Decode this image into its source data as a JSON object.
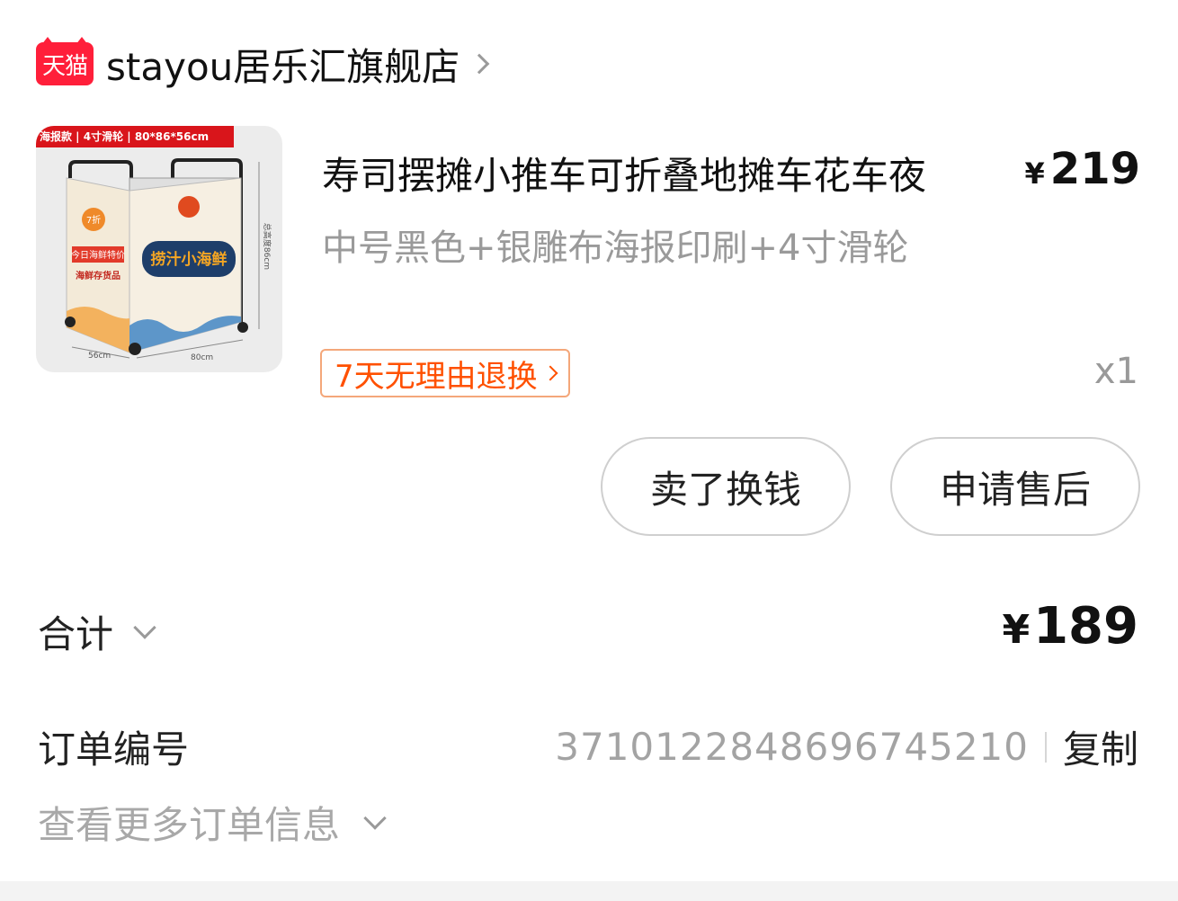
{
  "store": {
    "badge": "天猫",
    "name": "stayou居乐汇旗舰店"
  },
  "product": {
    "image_banner": "海报款 | 4寸滑轮 | 80*86*56cm",
    "image_text_1": "捞汁小海鲜",
    "image_text_2": "今日海鲜特价",
    "image_text_3": "海鲜存货品",
    "image_text_4": "7折",
    "image_dim_height": "总高度86cm",
    "image_dim_width": "80cm",
    "image_dim_depth": "56cm",
    "title": "寿司摆摊小推车可折叠地摊车花车夜",
    "price_symbol": "¥",
    "price": "219",
    "spec": "中号黑色+银雕布海报印刷+4寸滑轮",
    "return_policy": "7天无理由退换",
    "quantity": "x1"
  },
  "actions": {
    "sell": "卖了换钱",
    "after_sales": "申请售后"
  },
  "total": {
    "label": "合计",
    "symbol": "¥",
    "value": "189"
  },
  "order": {
    "label": "订单编号",
    "number": "3710122848696745210",
    "copy": "复制",
    "more": "查看更多订单信息"
  },
  "colors": {
    "tmall_red": "#ff1f3a",
    "accent_orange": "#ff5000"
  }
}
